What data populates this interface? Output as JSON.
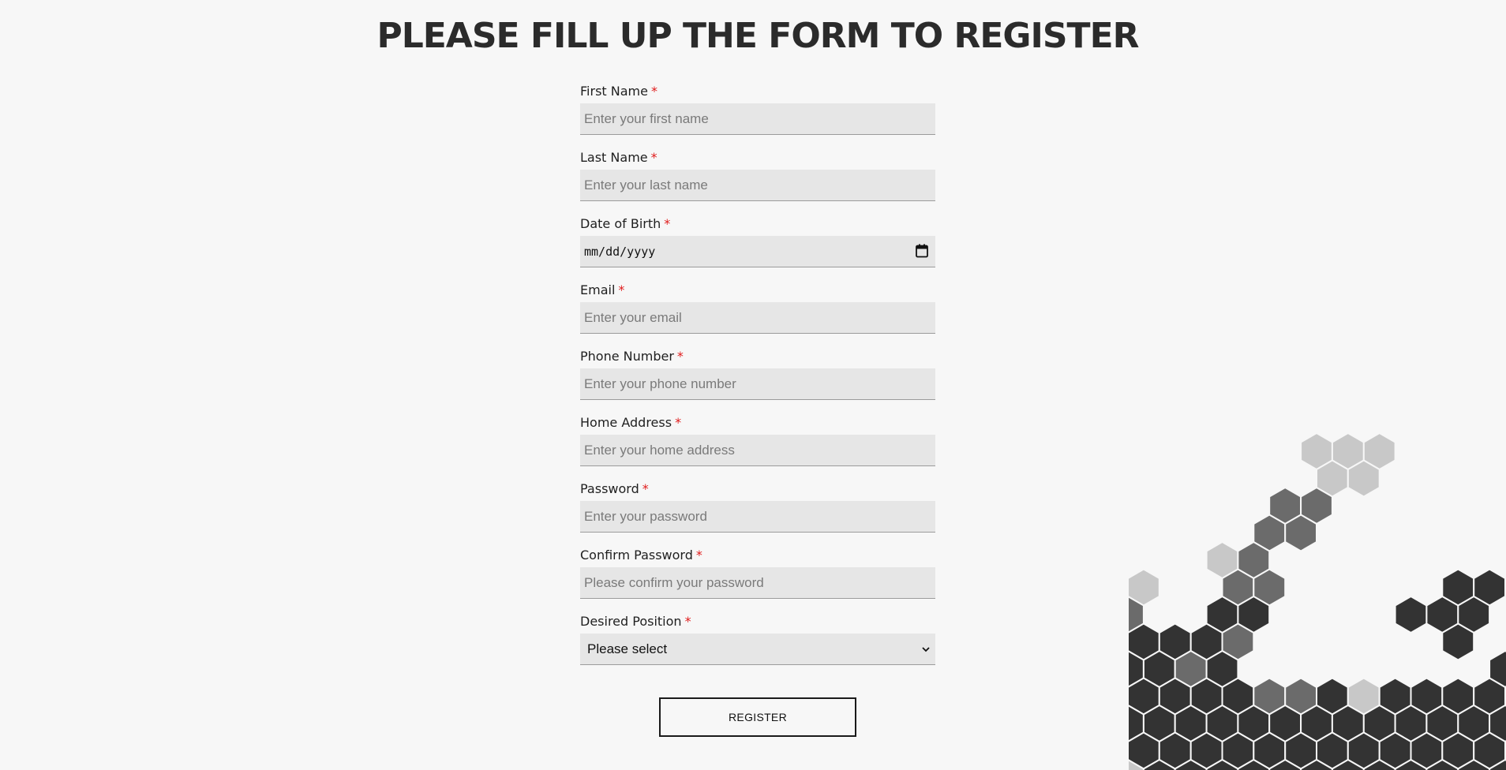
{
  "page": {
    "title": "PLEASE FILL UP THE FORM TO REGISTER"
  },
  "form": {
    "required_mark": "*",
    "fields": [
      {
        "label": "First Name",
        "placeholder": "Enter your first name",
        "value": ""
      },
      {
        "label": "Last Name",
        "placeholder": "Enter your last name",
        "value": ""
      },
      {
        "label": "Date of Birth",
        "display": "mm/dd/yyyy",
        "icon": "calendar-icon"
      },
      {
        "label": "Email",
        "placeholder": "Enter your email",
        "value": ""
      },
      {
        "label": "Phone Number",
        "placeholder": "Enter your phone number",
        "value": ""
      },
      {
        "label": "Home Address",
        "placeholder": "Enter your home address",
        "value": ""
      },
      {
        "label": "Password",
        "placeholder": "Enter your password",
        "value": ""
      },
      {
        "label": "Confirm Password",
        "placeholder": "Please confirm your password",
        "value": ""
      },
      {
        "label": "Desired Position",
        "selected": "Please select",
        "icon": "chevron-down-icon"
      }
    ],
    "submit_label": "REGISTER"
  },
  "colors": {
    "background": "#f7f7f7",
    "input_background": "#e6e6e6",
    "required": "#e01b1b",
    "hex_dark": "#333333",
    "hex_mid": "#6b6b6b",
    "hex_light": "#c8c8c8"
  }
}
